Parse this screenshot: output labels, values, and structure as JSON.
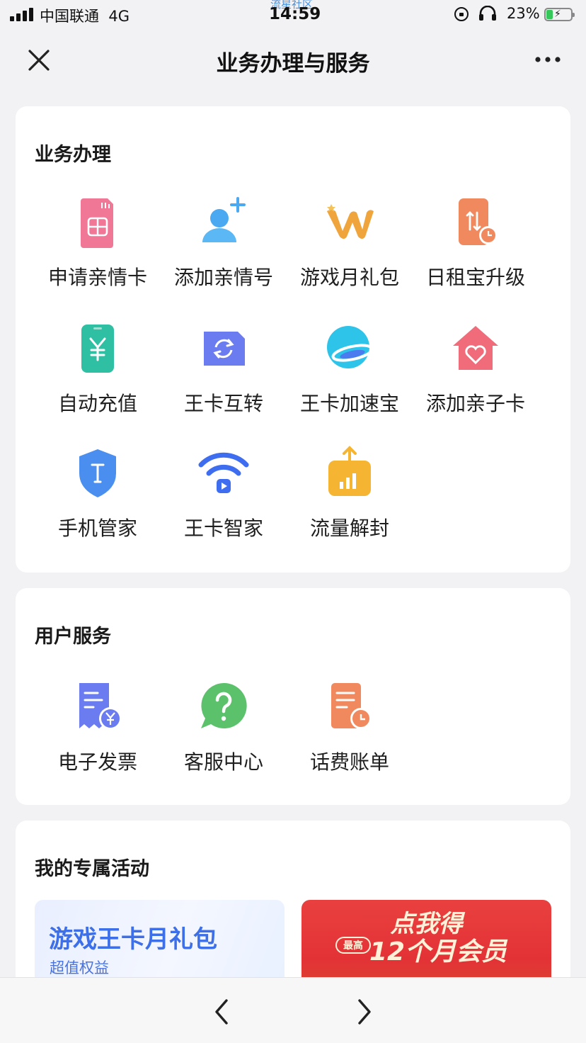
{
  "status_bar": {
    "carrier": "中国联通",
    "network": "4G",
    "time": "14:59",
    "watermark": "流星社区",
    "battery_percent": "23%",
    "icons": [
      "signal-icon",
      "orientation-lock-icon",
      "headphones-icon",
      "battery-charging-icon"
    ]
  },
  "nav": {
    "title": "业务办理与服务",
    "close_icon": "close-icon",
    "more_icon": "more-icon"
  },
  "business": {
    "title": "业务办理",
    "items": [
      {
        "label": "申请亲情卡",
        "icon": "sim-card-icon",
        "color": "#f07896"
      },
      {
        "label": "添加亲情号",
        "icon": "add-contact-icon",
        "color": "#4aa9f0"
      },
      {
        "label": "游戏月礼包",
        "icon": "game-w-icon",
        "color": "#f0a53c"
      },
      {
        "label": "日租宝升级",
        "icon": "phone-upgrade-icon",
        "color": "#f08a5e"
      },
      {
        "label": "自动充值",
        "icon": "phone-yen-icon",
        "color": "#2fbfa3"
      },
      {
        "label": "王卡互转",
        "icon": "card-transfer-icon",
        "color": "#6b7cf0"
      },
      {
        "label": "王卡加速宝",
        "icon": "planet-icon",
        "color": "#2ec3e8"
      },
      {
        "label": "添加亲子卡",
        "icon": "heart-house-icon",
        "color": "#f06c7a"
      },
      {
        "label": "手机管家",
        "icon": "shield-icon",
        "color": "#4a8ff0"
      },
      {
        "label": "王卡智家",
        "icon": "wifi-icon",
        "color": "#3f6df0"
      },
      {
        "label": "流量解封",
        "icon": "data-unlock-icon",
        "color": "#f5b533"
      }
    ]
  },
  "user_services": {
    "title": "用户服务",
    "items": [
      {
        "label": "电子发票",
        "icon": "invoice-icon",
        "color": "#6b7cf0"
      },
      {
        "label": "客服中心",
        "icon": "help-bubble-icon",
        "color": "#5bc26b"
      },
      {
        "label": "话费账单",
        "icon": "bill-icon",
        "color": "#f08a5e"
      }
    ]
  },
  "activities": {
    "title": "我的专属活动",
    "banners": [
      {
        "title": "游戏王卡月礼包",
        "subtitle": "超值权益"
      },
      {
        "title": "点我得",
        "badge": "最高",
        "subtitle": "12个月会员"
      }
    ]
  },
  "bottom_nav": {
    "back_icon": "chevron-left-icon",
    "forward_icon": "chevron-right-icon"
  }
}
